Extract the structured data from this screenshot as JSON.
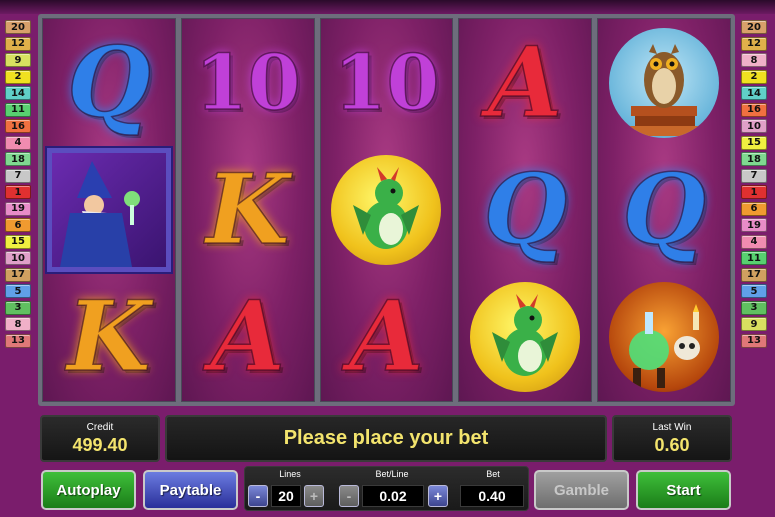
{
  "left_lines": [
    {
      "n": "20",
      "color": "#d8a06a"
    },
    {
      "n": "12",
      "color": "#e0b04a"
    },
    {
      "n": "9",
      "color": "#d8e060"
    },
    {
      "n": "2",
      "color": "#f0e020"
    },
    {
      "n": "14",
      "color": "#60d0c8"
    },
    {
      "n": "11",
      "color": "#58d070"
    },
    {
      "n": "16",
      "color": "#f07040"
    },
    {
      "n": "4",
      "color": "#f08cb0"
    },
    {
      "n": "18",
      "color": "#7fd890"
    },
    {
      "n": "7",
      "color": "#c8c8c8"
    },
    {
      "n": "1",
      "color": "#e03030"
    },
    {
      "n": "19",
      "color": "#e88cc8"
    },
    {
      "n": "6",
      "color": "#f09a30"
    },
    {
      "n": "15",
      "color": "#f0f040"
    },
    {
      "n": "10",
      "color": "#e0a0c8"
    },
    {
      "n": "17",
      "color": "#d0a060"
    },
    {
      "n": "5",
      "color": "#60a0e8"
    },
    {
      "n": "3",
      "color": "#60c060"
    },
    {
      "n": "8",
      "color": "#f0b0c8"
    },
    {
      "n": "13",
      "color": "#e07878"
    }
  ],
  "right_lines": [
    {
      "n": "20",
      "color": "#d8a06a"
    },
    {
      "n": "12",
      "color": "#e0b04a"
    },
    {
      "n": "8",
      "color": "#f0b0c8"
    },
    {
      "n": "2",
      "color": "#f0e020"
    },
    {
      "n": "14",
      "color": "#60d0c8"
    },
    {
      "n": "16",
      "color": "#f07040"
    },
    {
      "n": "10",
      "color": "#e0a0c8"
    },
    {
      "n": "15",
      "color": "#f0f040"
    },
    {
      "n": "18",
      "color": "#7fd890"
    },
    {
      "n": "7",
      "color": "#c8c8c8"
    },
    {
      "n": "1",
      "color": "#e03030"
    },
    {
      "n": "6",
      "color": "#f09a30"
    },
    {
      "n": "19",
      "color": "#e88cc8"
    },
    {
      "n": "4",
      "color": "#f08cb0"
    },
    {
      "n": "11",
      "color": "#58d070"
    },
    {
      "n": "17",
      "color": "#d0a060"
    },
    {
      "n": "5",
      "color": "#60a0e8"
    },
    {
      "n": "3",
      "color": "#60c060"
    },
    {
      "n": "9",
      "color": "#d8e060"
    },
    {
      "n": "13",
      "color": "#e07878"
    }
  ],
  "reels": [
    [
      {
        "type": "letter",
        "text": "Q",
        "color": "#2f7fe8",
        "icon": "q-symbol"
      },
      {
        "type": "wizard",
        "icon": "wizard-symbol"
      },
      {
        "type": "letter",
        "text": "K",
        "color": "#f0a020",
        "icon": "k-symbol"
      }
    ],
    [
      {
        "type": "ten",
        "text": "10",
        "color": "#c040d8",
        "icon": "ten-symbol"
      },
      {
        "type": "letter",
        "text": "K",
        "color": "#f0a020",
        "icon": "k-symbol"
      },
      {
        "type": "letter",
        "text": "A",
        "color": "#e82a3a",
        "icon": "a-symbol"
      }
    ],
    [
      {
        "type": "ten",
        "text": "10",
        "color": "#c040d8",
        "icon": "ten-symbol"
      },
      {
        "type": "dragon",
        "icon": "dragon-symbol"
      },
      {
        "type": "letter",
        "text": "A",
        "color": "#e82a3a",
        "icon": "a-symbol"
      }
    ],
    [
      {
        "type": "letter",
        "text": "A",
        "color": "#e82a3a",
        "icon": "a-symbol"
      },
      {
        "type": "letter",
        "text": "Q",
        "color": "#2f7fe8",
        "icon": "q-symbol"
      },
      {
        "type": "dragon",
        "icon": "dragon-symbol"
      }
    ],
    [
      {
        "type": "owl",
        "icon": "owl-symbol"
      },
      {
        "type": "letter",
        "text": "Q",
        "color": "#2f7fe8",
        "icon": "q-symbol"
      },
      {
        "type": "potion",
        "icon": "potion-symbol"
      }
    ]
  ],
  "credit": {
    "label": "Credit",
    "value": "499.40"
  },
  "message": "Please place your bet",
  "last_win": {
    "label": "Last Win",
    "value": "0.60"
  },
  "buttons": {
    "autoplay": "Autoplay",
    "paytable": "Paytable",
    "gamble": "Gamble",
    "start": "Start"
  },
  "bet_panel": {
    "lines_label": "Lines",
    "lines_value": "20",
    "bet_line_label": "Bet/Line",
    "bet_line_value": "0.02",
    "bet_label": "Bet",
    "bet_value": "0.40",
    "minus": "-",
    "plus": "+"
  },
  "colors": {
    "accent_text": "#f3e46d",
    "background": "#7a1d6c",
    "green_button": "#2a9a28",
    "blue_button": "#3a42b0"
  }
}
